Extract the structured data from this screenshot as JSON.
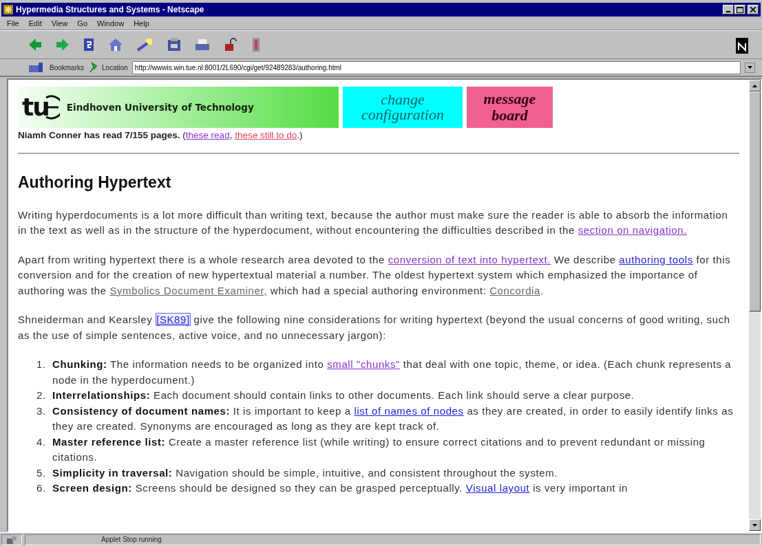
{
  "window": {
    "title": "Hypermedia Structures and Systems - Netscape"
  },
  "menu": [
    "File",
    "Edit",
    "View",
    "Go",
    "Window",
    "Help"
  ],
  "location_bar": {
    "bookmarks_label": "Bookmarks",
    "location_label": "Location",
    "url": "http://wwwis.win.tue.nl:8001/2L690/cgi/get/92489283/authoring.html"
  },
  "banner": {
    "logo_text": "tu",
    "university": "Eindhoven University of Technology",
    "change": "change configuration",
    "message": "message board"
  },
  "progress": [
    {
      "text": "Niamh Conner has read 7/155 pages.",
      "kind": "bold"
    },
    {
      "text": " (",
      "kind": "plain"
    },
    {
      "text": "these read",
      "kind": "visited"
    },
    {
      "text": ", ",
      "kind": "plain"
    },
    {
      "text": "these still to do",
      "kind": "pending"
    },
    {
      "text": ".)",
      "kind": "plain"
    }
  ],
  "heading": "Authoring Hypertext",
  "paragraphs": [
    [
      {
        "text": "Writing hyperdocuments is a lot more difficult than writing text, because the author must make sure the reader is able to absorb the information in the text as well as in the structure of the hyperdocument, without encountering the difficulties described in the ",
        "kind": "plain"
      },
      {
        "text": "section on navigation.",
        "kind": "visited"
      }
    ],
    [
      {
        "text": "Apart from writing hypertext there is a whole research area devoted to the ",
        "kind": "plain"
      },
      {
        "text": "conversion of text into hypertext.",
        "kind": "visited"
      },
      {
        "text": " We describe ",
        "kind": "plain"
      },
      {
        "text": "authoring tools",
        "kind": "link"
      },
      {
        "text": " for this conversion and for the creation of new hypertextual material a number. The oldest hypertext system which emphasized the importance of authoring was the ",
        "kind": "plain"
      },
      {
        "text": "Symbolics Document Examiner,",
        "kind": "faded"
      },
      {
        "text": " which had a special authoring environment: ",
        "kind": "plain"
      },
      {
        "text": "Concordia",
        "kind": "faded"
      },
      {
        "text": ".",
        "kind": "plain"
      }
    ],
    [
      {
        "text": "Shneiderman and Kearsley ",
        "kind": "plain"
      },
      {
        "text": "[SK89]",
        "kind": "cited"
      },
      {
        "text": " give the following nine considerations for writing hypertext (beyond the usual concerns of good writing, such as the use of simple sentences, active voice, and no unnecessary jargon):",
        "kind": "plain"
      }
    ]
  ],
  "considerations": [
    {
      "number": "1.",
      "term": "Chunking:",
      "text": [
        {
          "text": " The information needs to be organized into ",
          "kind": "plain"
        },
        {
          "text": "small \"chunks\"",
          "kind": "visited"
        },
        {
          "text": " that deal with one topic, theme, or idea. (Each chunk represents a node in the hyperdocument.)",
          "kind": "plain"
        }
      ]
    },
    {
      "number": "2.",
      "term": "Interrelationships:",
      "text": [
        {
          "text": " Each document should contain links to other documents. Each link should serve a clear purpose.",
          "kind": "plain"
        }
      ]
    },
    {
      "number": "3.",
      "term": "Consistency of document names:",
      "text": [
        {
          "text": " It is important to keep a ",
          "kind": "plain"
        },
        {
          "text": "list of names of nodes",
          "kind": "link"
        },
        {
          "text": " as they are created, in order to easily identify links as they are created. Synonyms are encouraged as long as they are kept track of.",
          "kind": "plain"
        }
      ]
    },
    {
      "number": "4.",
      "term": "Master reference list:",
      "text": [
        {
          "text": " Create a master reference list (while writing) to ensure correct citations and to prevent redundant or missing citations.",
          "kind": "plain"
        }
      ]
    },
    {
      "number": "5.",
      "term": "Simplicity in traversal:",
      "text": [
        {
          "text": " Navigation should be simple, intuitive, and consistent throughout the system.",
          "kind": "plain"
        }
      ]
    },
    {
      "number": "6.",
      "term": "Screen design:",
      "text": [
        {
          "text": " Screens should be designed so they can be grasped perceptually. ",
          "kind": "plain"
        },
        {
          "text": "Visual layout",
          "kind": "link"
        },
        {
          "text": " is very important in",
          "kind": "plain"
        }
      ]
    }
  ],
  "status_bar": {
    "text": "Applet Stop running"
  }
}
